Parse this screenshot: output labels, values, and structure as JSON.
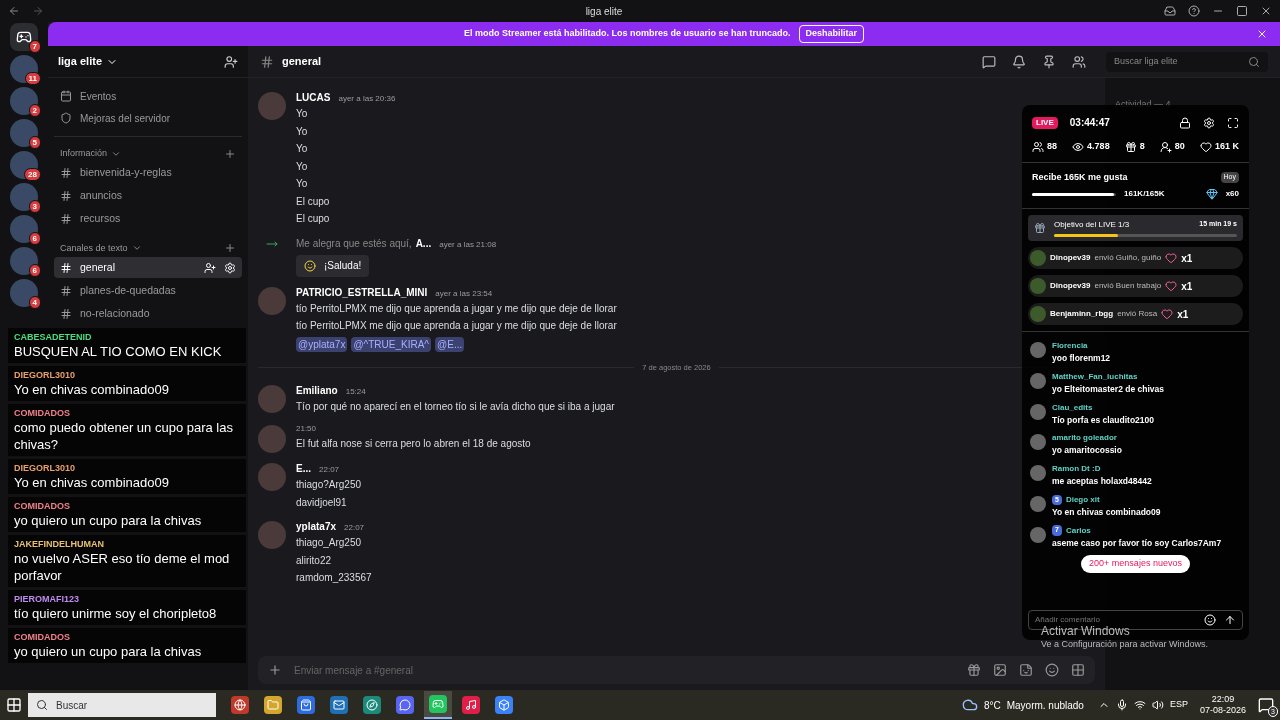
{
  "window": {
    "title": "liga elite"
  },
  "banner": {
    "text": "El modo Streamer está habilitado. Los nombres de usuario se han truncado.",
    "button": "Deshabilitar"
  },
  "servers": [
    {
      "kind": "home",
      "badge": "7"
    },
    {
      "kind": "server",
      "badge": "11"
    },
    {
      "kind": "server",
      "badge": "2"
    },
    {
      "kind": "server",
      "badge": "5"
    },
    {
      "kind": "server",
      "badge": "28"
    },
    {
      "kind": "server",
      "badge": "3"
    },
    {
      "kind": "server",
      "badge": "6"
    },
    {
      "kind": "server",
      "badge": "6"
    },
    {
      "kind": "server",
      "badge": "4"
    }
  ],
  "sidebar": {
    "server_name": "liga elite",
    "top_items": [
      {
        "kind": "calendar",
        "label": "Eventos"
      },
      {
        "kind": "boost",
        "label": "Mejoras del servidor"
      }
    ],
    "categories": [
      {
        "name": "Información",
        "channels": [
          {
            "name": "bienvenida-y-reglas",
            "selected": false
          },
          {
            "name": "anuncios",
            "selected": false
          },
          {
            "name": "recursos",
            "selected": false
          }
        ]
      },
      {
        "name": "Canales de texto",
        "channels": [
          {
            "name": "general",
            "selected": true
          },
          {
            "name": "planes-de-quedadas",
            "selected": false
          },
          {
            "name": "no-relacionado",
            "selected": false
          }
        ]
      }
    ]
  },
  "chat": {
    "channel": "general",
    "search_placeholder": "Buscar liga elite",
    "messages": [
      {
        "kind": "message",
        "author": "LUCAS",
        "time": "ayer a las 20:36",
        "lines": [
          "Yo",
          "Yo",
          "Yo",
          "Yo",
          "Yo",
          "El cupo",
          "El cupo"
        ]
      },
      {
        "kind": "join",
        "text": "Me alegra que estés aquí,",
        "name": "A...",
        "time": "ayer a las 21:08",
        "button": "¡Saluda!"
      },
      {
        "kind": "message",
        "author": "PATRICIO_ESTRELLA_MINI",
        "time": "ayer a las 23:54",
        "lines": [
          "tío PerritoLPMX me dijo que aprenda a jugar y me dijo que deje de llorar",
          "tío PerritoLPMX me dijo que aprenda a jugar y me dijo que deje de llorar"
        ],
        "mentions": [
          "@yplata7x",
          "@^TRUE_KIRA^",
          "@E..."
        ]
      },
      {
        "kind": "divider",
        "text": "7 de agosto de 2026"
      },
      {
        "kind": "message",
        "author": "Emiliano",
        "time": "15:24",
        "lines": [
          "Tío por qué no aparecí en el torneo tío si le avía dicho que si iba a jugar"
        ]
      },
      {
        "kind": "message",
        "time": "21:50",
        "lines": [
          "El fut alfa nose si cerra pero lo abren el 18 de agosto"
        ]
      },
      {
        "kind": "message",
        "author": "E...",
        "time": "22:07",
        "lines": [
          "thiago?Arg250",
          "davidjoel91"
        ]
      },
      {
        "kind": "message",
        "author": "yplata7x",
        "time": "22:07",
        "lines": [
          "thiago_Arg250",
          "alirito22",
          "ramdom_233567"
        ]
      }
    ],
    "input_placeholder": "Enviar mensaje a #general"
  },
  "members": {
    "heading": "Actividad — 4"
  },
  "stream_chat": [
    {
      "name": "CABESADETENID",
      "color": "#4ade80",
      "text": "BUSQUEN AL TIO COMO EN KICK"
    },
    {
      "name": "DIEGORL3010",
      "color": "#e8a06a",
      "text": "Yo en chivas combinado09"
    },
    {
      "name": "COMIDADOS",
      "color": "#f0808a",
      "text": "como puedo obtener un cupo para las chivas?"
    },
    {
      "name": "DIEGORL3010",
      "color": "#e8a06a",
      "text": "Yo en chivas combinado09"
    },
    {
      "name": "COMIDADOS",
      "color": "#f0808a",
      "text": "yo quiero un cupo para la chivas"
    },
    {
      "name": "JAKEFINDELHUMAN",
      "color": "#e8c070",
      "text": "no vuelvo ASER eso tío deme el mod porfavor"
    },
    {
      "name": "PIEROMAFI123",
      "color": "#c08af0",
      "text": "tío quiero unirme soy el choripleto8"
    },
    {
      "name": "COMIDADOS",
      "color": "#f0808a",
      "text": "yo quiero un cupo para la chivas"
    }
  ],
  "live": {
    "badge": "LIVE",
    "timer": "03:44:47",
    "stats": [
      {
        "kind": "viewers",
        "value": "88"
      },
      {
        "kind": "views",
        "value": "4.788"
      },
      {
        "kind": "gifts",
        "value": "8"
      },
      {
        "kind": "followers",
        "value": "80"
      },
      {
        "kind": "likes",
        "value": "161 K"
      }
    ],
    "like_goal": {
      "title": "Recibe 165K me gusta",
      "progress": "161K/165K",
      "level": 0.98,
      "tag": "Hoy",
      "reward": "x60"
    },
    "live_goal": {
      "title": "Objetivo del LIVE 1/3",
      "time": "15 min 19 s",
      "level": 0.35
    },
    "gifts": [
      {
        "user": "Dinopev39",
        "text": "envió Guiño, guiño",
        "count": "x1"
      },
      {
        "user": "Dinopev39",
        "text": "envió Buen trabajo",
        "count": "x1"
      },
      {
        "user": "Benjaminn_rbgg",
        "text": "envió Rosa",
        "count": "x1"
      }
    ],
    "comments": [
      {
        "user": "Florencia",
        "text": "yoo florenm12"
      },
      {
        "user": "Matthew_Fan_luchitas",
        "text": "yo Elteitomaster2 de chivas"
      },
      {
        "user": "Clau_edits",
        "text": "Tío porfa es claudito2100"
      },
      {
        "user": "amarito goleador",
        "text": "yo amaritocossio"
      },
      {
        "user": "Ramon Dt :D",
        "text": "me aceptas holaxd48442"
      },
      {
        "user": "Diego xit",
        "level_badge": "5",
        "text": "Yo en chivas combinado09"
      },
      {
        "user": "Carlos",
        "level_badge": "7",
        "text": "aseme caso por favor tío soy Carlos7Am7"
      }
    ],
    "new_messages": "200+ mensajes nuevos",
    "input_placeholder": "Añadir comentario"
  },
  "activation": {
    "title": "Activar Windows",
    "text": "Ve a Configuración para activar Windows."
  },
  "taskbar": {
    "search_placeholder": "Buscar",
    "apps": [
      {
        "kind": "browser",
        "selected": false
      },
      {
        "kind": "folder",
        "selected": false
      },
      {
        "kind": "store",
        "selected": false
      },
      {
        "kind": "mail",
        "selected": false
      },
      {
        "kind": "edge",
        "selected": false
      },
      {
        "kind": "chat",
        "selected": false
      },
      {
        "kind": "game",
        "selected": true
      },
      {
        "kind": "video",
        "selected": false
      },
      {
        "kind": "block",
        "selected": false
      }
    ],
    "temperature": "8°C",
    "weather": "Mayorm. nublado",
    "language": "ESP",
    "time": "22:09",
    "date": "07-08-2026",
    "notifications": "3"
  }
}
